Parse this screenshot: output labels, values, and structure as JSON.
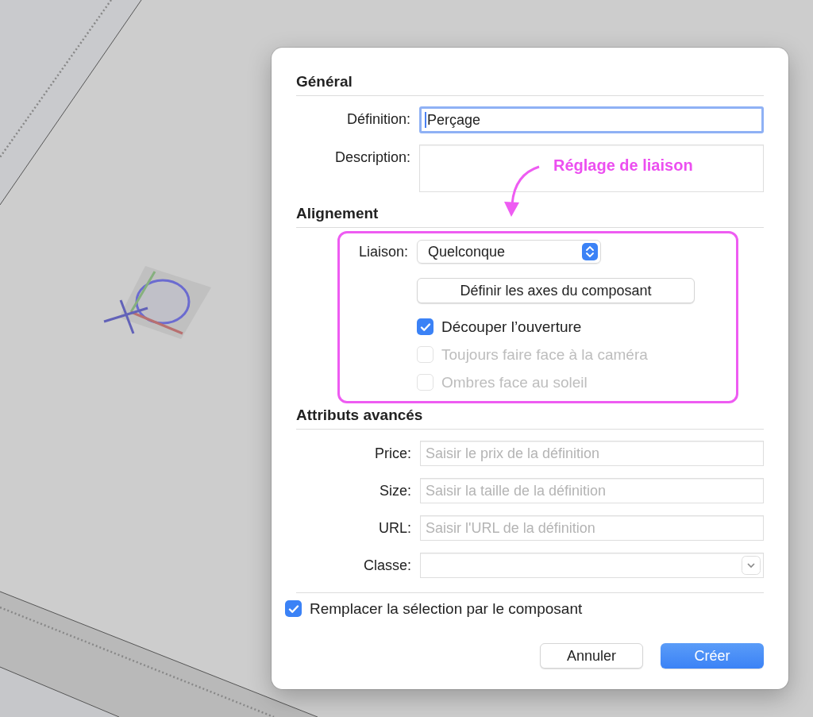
{
  "general": {
    "title": "Général",
    "fields": [
      {
        "kind": "text",
        "label": "Définition:",
        "value": "Perçage",
        "focused": true
      },
      {
        "kind": "textarea",
        "label": "Description:"
      }
    ]
  },
  "annotation": {
    "text": "Réglage de liaison"
  },
  "alignment": {
    "title": "Alignement",
    "binding": {
      "label": "Liaison:",
      "value": "Quelconque"
    },
    "axes_button": "Définir les axes du composant",
    "options": [
      {
        "label": "Découper l’ouverture",
        "checked": true,
        "disabled": false
      },
      {
        "label": "Toujours faire face à la caméra",
        "checked": false,
        "disabled": true
      },
      {
        "label": "Ombres face au soleil",
        "checked": false,
        "disabled": true
      }
    ]
  },
  "advanced": {
    "title": "Attributs avancés",
    "fields": [
      {
        "kind": "text",
        "label": "Price:",
        "placeholder": "Saisir le prix de la définition"
      },
      {
        "kind": "text",
        "label": "Size:",
        "placeholder": "Saisir la taille de la définition"
      },
      {
        "kind": "text",
        "label": "URL:",
        "placeholder": "Saisir l'URL de la définition"
      },
      {
        "kind": "select",
        "label": "Classe:"
      }
    ]
  },
  "replace_selection": {
    "label": "Remplacer la sélection par le composant",
    "checked": true
  },
  "buttons": [
    {
      "label": "Annuler",
      "primary": false
    },
    {
      "label": "Créer",
      "primary": true
    }
  ]
}
